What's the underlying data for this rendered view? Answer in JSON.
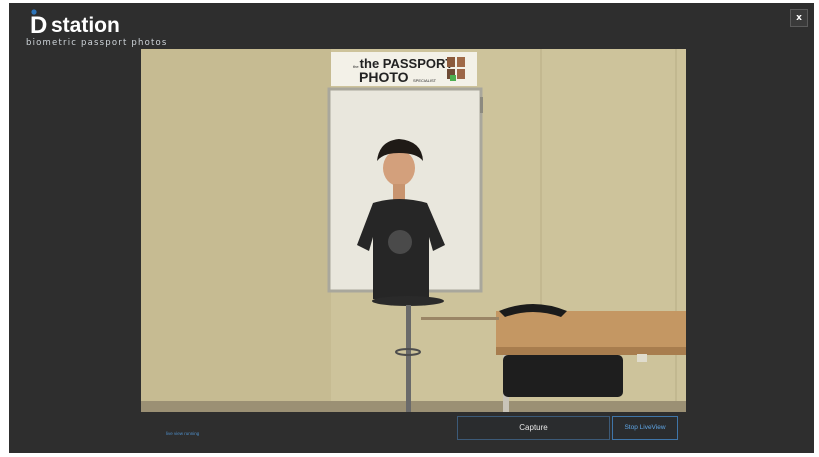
{
  "header": {
    "logo_text": "station",
    "logo_letter": "D",
    "tagline": "biometric passport photos",
    "close_label": "x"
  },
  "liveview": {
    "sign_line1": "the PASSPORT",
    "sign_line2": "PHOTO",
    "sign_line3": "SPECIALIST"
  },
  "footer": {
    "status_text": "live view running",
    "capture_label": "Capture",
    "stop_label": "Stop LiveView"
  },
  "colors": {
    "background": "#2e2e2e",
    "accent": "#4f8fc9",
    "logo_blue": "#2e74b8"
  }
}
